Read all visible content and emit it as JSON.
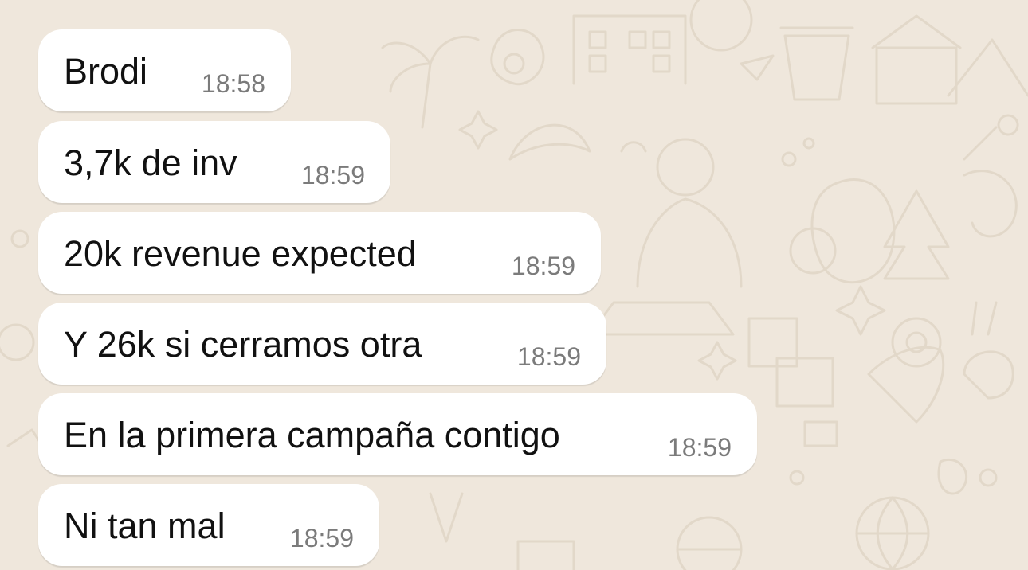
{
  "messages": [
    {
      "text": "Brodi",
      "time": "18:58"
    },
    {
      "text": "3,7k de inv",
      "time": "18:59"
    },
    {
      "text": "20k revenue expected",
      "time": "18:59"
    },
    {
      "text": "Y 26k si cerramos otra",
      "time": "18:59"
    },
    {
      "text": "En la primera campaña contigo",
      "time": "18:59"
    },
    {
      "text": "Ni tan mal",
      "time": "18:59"
    }
  ],
  "theme": {
    "background": "#efe7dc",
    "bubble": "#ffffff",
    "text": "#111111",
    "timestamp": "#7b7b7b"
  }
}
